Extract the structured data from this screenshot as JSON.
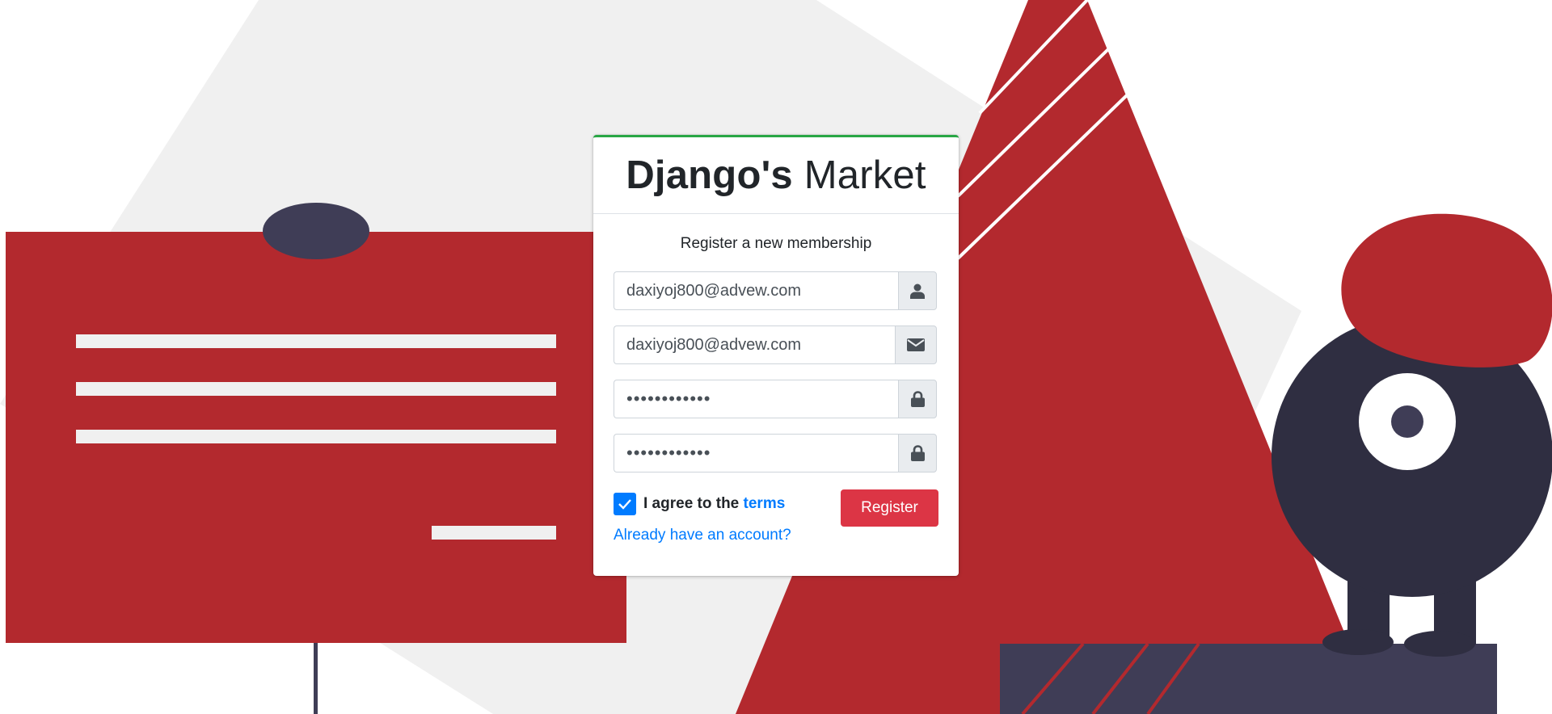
{
  "brand": {
    "bold": "Django's",
    "light": "Market"
  },
  "form": {
    "message": "Register a new membership",
    "username_value": "daxiyoj800@advew.com",
    "email_value": "daxiyoj800@advew.com",
    "password_value": "••••••••••••",
    "password_confirm_value": "••••••••••••",
    "agree_prefix": "I agree to the",
    "terms_label": "terms",
    "register_label": "Register",
    "login_link_label": "Already have an account?",
    "agree_checked": true
  },
  "icons": {
    "username": "user-icon",
    "email": "envelope-icon",
    "password": "lock-icon",
    "password_confirm": "lock-icon"
  },
  "colors": {
    "accent_red": "#b3292e",
    "dark_navy": "#3f3d56",
    "light_gray": "#f0f0f0",
    "card_border_top": "#28a745",
    "primary_blue": "#007bff",
    "danger_red": "#dc3545"
  }
}
